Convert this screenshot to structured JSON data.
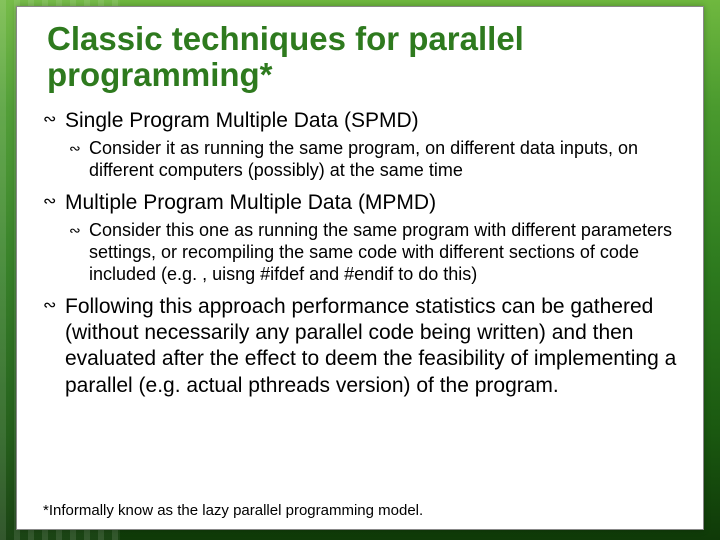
{
  "title": "Classic techniques for parallel programming*",
  "points": {
    "p1": "Single Program Multiple Data (SPMD)",
    "p1_sub": "Consider it as running the same program, on different data inputs, on different computers (possibly) at the same time",
    "p2": "Multiple Program Multiple Data (MPMD)",
    "p2_sub": "Consider this one as running the same program with different parameters settings, or recompiling the same code with different sections of code included (e.g. , uisng #ifdef and #endif to  do this)",
    "p3": "Following this approach performance statistics can be gathered (without necessarily any parallel code being written) and then evaluated after the effect to deem the feasibility of implementing a parallel (e.g. actual pthreads version) of the program."
  },
  "footnote": "*Informally know as the lazy parallel programming model."
}
